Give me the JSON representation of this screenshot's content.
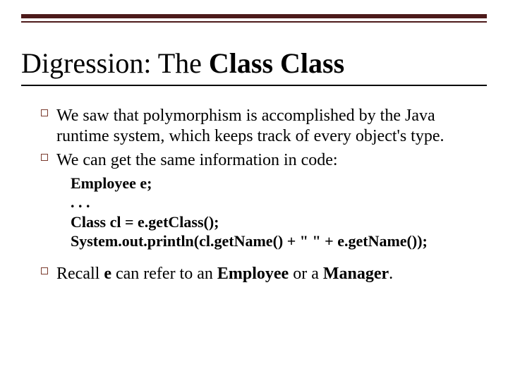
{
  "title": {
    "prefix": "Digression: The ",
    "bold": "Class Class"
  },
  "bullets": {
    "b1": "We saw that polymorphism is accomplished by the Java runtime system, which keeps track of every object's type.",
    "b2": "We can get the same information in code:",
    "b3_pre": "Recall ",
    "b3_e": "e",
    "b3_mid": " can refer to an ",
    "b3_emp": "Employee",
    "b3_or": " or a ",
    "b3_mgr": "Manager",
    "b3_end": "."
  },
  "code": {
    "l1": "Employee e;",
    "l2": ". . .",
    "l3": "Class cl = e.getClass();",
    "l4": "System.out.println(cl.getName() + \" \" + e.getName());"
  }
}
